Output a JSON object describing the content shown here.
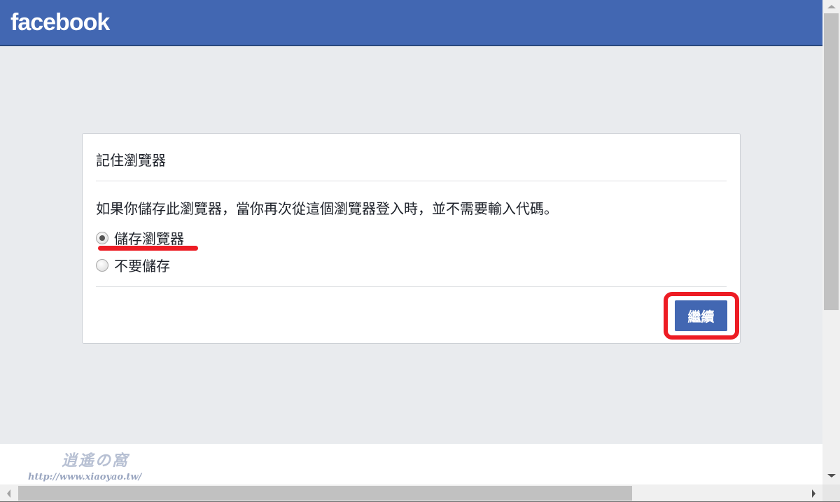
{
  "header": {
    "logo_text": "facebook",
    "brand_color": "#4267b2"
  },
  "dialog": {
    "title": "記住瀏覽器",
    "description": "如果你儲存此瀏覽器，當你再次從這個瀏覽器登入時，並不需要輸入代碼。",
    "options": [
      {
        "label": "儲存瀏覽器",
        "selected": true
      },
      {
        "label": "不要儲存",
        "selected": false
      }
    ],
    "continue_label": "繼續"
  },
  "annotations": {
    "highlight_color": "#ed1c24"
  },
  "watermark": {
    "logo_text": "逍遙の窩",
    "url": "http://www.xiaoyao.tw/"
  },
  "scrollbars": {
    "vertical_icons": {
      "up": "arrow-up-icon",
      "down": "arrow-down-icon"
    },
    "horizontal_icons": {
      "left": "arrow-left-icon",
      "right": "arrow-right-icon"
    }
  }
}
